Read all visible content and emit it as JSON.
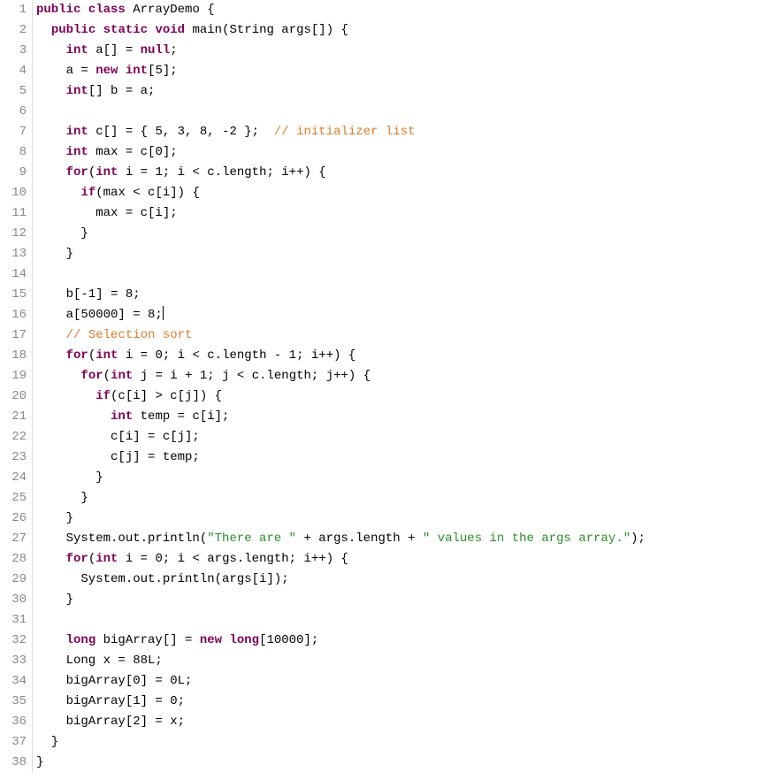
{
  "lineCount": 38,
  "lines": [
    [
      {
        "t": "public",
        "c": "kw"
      },
      {
        "t": " ",
        "c": "default"
      },
      {
        "t": "class",
        "c": "kw"
      },
      {
        "t": " ArrayDemo {",
        "c": "default"
      }
    ],
    [
      {
        "t": "  ",
        "c": "default"
      },
      {
        "t": "public",
        "c": "kw"
      },
      {
        "t": " ",
        "c": "default"
      },
      {
        "t": "static",
        "c": "kw"
      },
      {
        "t": " ",
        "c": "default"
      },
      {
        "t": "void",
        "c": "kw"
      },
      {
        "t": " main(String args[]) {",
        "c": "default"
      }
    ],
    [
      {
        "t": "    ",
        "c": "default"
      },
      {
        "t": "int",
        "c": "kw"
      },
      {
        "t": " a[] = ",
        "c": "default"
      },
      {
        "t": "null",
        "c": "kw"
      },
      {
        "t": ";",
        "c": "default"
      }
    ],
    [
      {
        "t": "    a = ",
        "c": "default"
      },
      {
        "t": "new",
        "c": "kw"
      },
      {
        "t": " ",
        "c": "default"
      },
      {
        "t": "int",
        "c": "kw"
      },
      {
        "t": "[5];",
        "c": "default"
      }
    ],
    [
      {
        "t": "    ",
        "c": "default"
      },
      {
        "t": "int",
        "c": "kw"
      },
      {
        "t": "[] b = a;",
        "c": "default"
      }
    ],
    [
      {
        "t": "",
        "c": "default"
      }
    ],
    [
      {
        "t": "    ",
        "c": "default"
      },
      {
        "t": "int",
        "c": "kw"
      },
      {
        "t": " c[] = { 5, 3, 8, -2 };  ",
        "c": "default"
      },
      {
        "t": "// initializer list",
        "c": "comment"
      }
    ],
    [
      {
        "t": "    ",
        "c": "default"
      },
      {
        "t": "int",
        "c": "kw"
      },
      {
        "t": " max = c[0];",
        "c": "default"
      }
    ],
    [
      {
        "t": "    ",
        "c": "default"
      },
      {
        "t": "for",
        "c": "kw"
      },
      {
        "t": "(",
        "c": "default"
      },
      {
        "t": "int",
        "c": "kw"
      },
      {
        "t": " i = 1; i < c.length; i++) {",
        "c": "default"
      }
    ],
    [
      {
        "t": "      ",
        "c": "default"
      },
      {
        "t": "if",
        "c": "kw"
      },
      {
        "t": "(max < c[i]) {",
        "c": "default"
      }
    ],
    [
      {
        "t": "        max = c[i];",
        "c": "default"
      }
    ],
    [
      {
        "t": "      }",
        "c": "default"
      }
    ],
    [
      {
        "t": "    }",
        "c": "default"
      }
    ],
    [
      {
        "t": "",
        "c": "default"
      }
    ],
    [
      {
        "t": "    b[-1] = 8;",
        "c": "default"
      }
    ],
    [
      {
        "t": "    a[50000] = 8;",
        "c": "default",
        "cursor": true
      }
    ],
    [
      {
        "t": "    ",
        "c": "default"
      },
      {
        "t": "// Selection sort",
        "c": "comment"
      }
    ],
    [
      {
        "t": "    ",
        "c": "default"
      },
      {
        "t": "for",
        "c": "kw"
      },
      {
        "t": "(",
        "c": "default"
      },
      {
        "t": "int",
        "c": "kw"
      },
      {
        "t": " i = 0; i < c.length - 1; i++) {",
        "c": "default"
      }
    ],
    [
      {
        "t": "      ",
        "c": "default"
      },
      {
        "t": "for",
        "c": "kw"
      },
      {
        "t": "(",
        "c": "default"
      },
      {
        "t": "int",
        "c": "kw"
      },
      {
        "t": " j = i + 1; j < c.length; j++) {",
        "c": "default"
      }
    ],
    [
      {
        "t": "        ",
        "c": "default"
      },
      {
        "t": "if",
        "c": "kw"
      },
      {
        "t": "(c[i] > c[j]) {",
        "c": "default"
      }
    ],
    [
      {
        "t": "          ",
        "c": "default"
      },
      {
        "t": "int",
        "c": "kw"
      },
      {
        "t": " temp = c[i];",
        "c": "default"
      }
    ],
    [
      {
        "t": "          c[i] = c[j];",
        "c": "default"
      }
    ],
    [
      {
        "t": "          c[j] = temp;",
        "c": "default"
      }
    ],
    [
      {
        "t": "        }",
        "c": "default"
      }
    ],
    [
      {
        "t": "      }",
        "c": "default"
      }
    ],
    [
      {
        "t": "    }",
        "c": "default"
      }
    ],
    [
      {
        "t": "    System.out.println(",
        "c": "default"
      },
      {
        "t": "\"There are \"",
        "c": "str"
      },
      {
        "t": " + args.length + ",
        "c": "default"
      },
      {
        "t": "\" values in the args array.\"",
        "c": "str"
      },
      {
        "t": ");",
        "c": "default"
      }
    ],
    [
      {
        "t": "    ",
        "c": "default"
      },
      {
        "t": "for",
        "c": "kw"
      },
      {
        "t": "(",
        "c": "default"
      },
      {
        "t": "int",
        "c": "kw"
      },
      {
        "t": " i = 0; i < args.length; i++) {",
        "c": "default"
      }
    ],
    [
      {
        "t": "      System.out.println(args[i]);",
        "c": "default"
      }
    ],
    [
      {
        "t": "    }",
        "c": "default"
      }
    ],
    [
      {
        "t": "",
        "c": "default"
      }
    ],
    [
      {
        "t": "    ",
        "c": "default"
      },
      {
        "t": "long",
        "c": "kw"
      },
      {
        "t": " bigArray[] = ",
        "c": "default"
      },
      {
        "t": "new",
        "c": "kw"
      },
      {
        "t": " ",
        "c": "default"
      },
      {
        "t": "long",
        "c": "kw"
      },
      {
        "t": "[10000];",
        "c": "default"
      }
    ],
    [
      {
        "t": "    Long x = 88L;",
        "c": "default"
      }
    ],
    [
      {
        "t": "    bigArray[0] = 0L;",
        "c": "default"
      }
    ],
    [
      {
        "t": "    bigArray[1] = 0;",
        "c": "default"
      }
    ],
    [
      {
        "t": "    bigArray[2] = x;",
        "c": "default"
      }
    ],
    [
      {
        "t": "  }",
        "c": "default"
      }
    ],
    [
      {
        "t": "}",
        "c": "default"
      }
    ]
  ]
}
